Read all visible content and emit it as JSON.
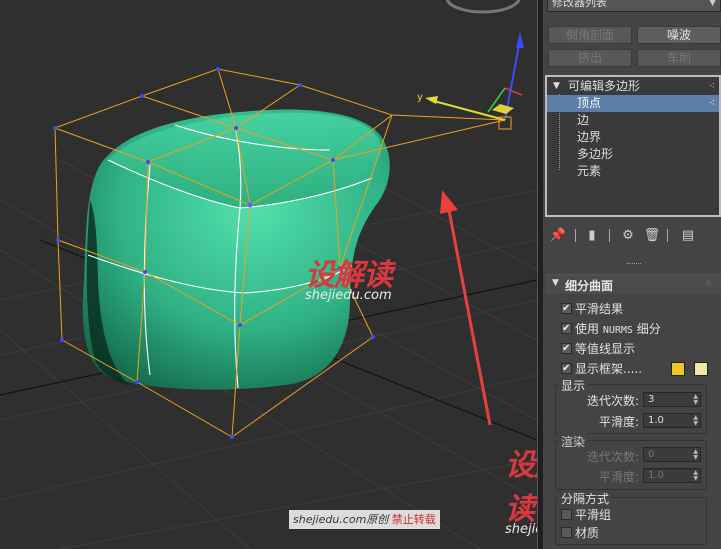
{
  "modifier_panel": {
    "modifier_list_label": "修改器列表",
    "buttons": {
      "bevel_profile": "倒角剖面",
      "noise": "噪波",
      "extrude": "挤出",
      "lathe": "车削"
    },
    "stack": {
      "root": "可编辑多边形",
      "items": [
        "顶点",
        "边",
        "边界",
        "多边形",
        "元素"
      ],
      "selected_index": 0
    }
  },
  "subdivision_rollout": {
    "title": "细分曲面",
    "checkboxes": [
      {
        "label": "平滑结果",
        "checked": true
      },
      {
        "label": "使用",
        "suffix_mono": "NURMS",
        "suffix": "细分",
        "checked": true
      },
      {
        "label": "等值线显示",
        "checked": true
      },
      {
        "label": "显示框架.....",
        "checked": true
      }
    ],
    "frame_colors": [
      "#f2c42c",
      "#f0e8a0"
    ],
    "display_group": {
      "label": "显示",
      "iterations_label": "迭代次数:",
      "iterations_value": "3",
      "smoothness_label": "平滑度:",
      "smoothness_value": "1.0"
    },
    "render_group": {
      "label": "渲染",
      "iterations_label": "迭代次数:",
      "iterations_value": "0",
      "smoothness_label": "平滑度:",
      "smoothness_value": "1.0"
    },
    "separate_by_group": {
      "label": "分隔方式",
      "options": [
        {
          "label": "平滑组",
          "checked": false
        },
        {
          "label": "材质",
          "checked": false
        }
      ]
    }
  },
  "viewport": {
    "gizmo_y_label": "y",
    "mesh_color": "#2fb184",
    "cage_color": "#f0a020",
    "arrow_color": "#e8413d"
  },
  "watermarks": {
    "brand_cn": "设解读",
    "brand_url": "shejiedu.com",
    "credit_site": "shejiedu.com原创",
    "credit_notice": "禁止转载"
  }
}
